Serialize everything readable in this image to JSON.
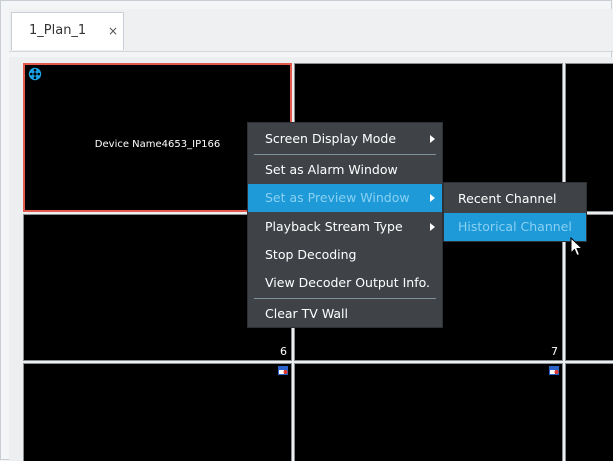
{
  "tab": {
    "label": "1_Plan_1",
    "close_glyph": "×"
  },
  "cells": {
    "c1": {
      "device_name": "Device Name4653_IP166"
    },
    "c6": {
      "number": "6"
    },
    "c7": {
      "number": "7"
    }
  },
  "context_menu": {
    "items": [
      {
        "label": "Screen Display Mode"
      },
      {
        "label": "Set as Alarm Window"
      },
      {
        "label": "Set as Preview Window"
      },
      {
        "label": "Playback Stream Type"
      },
      {
        "label": "Stop Decoding"
      },
      {
        "label": "View Decoder Output Info."
      },
      {
        "label": "Clear TV Wall"
      }
    ]
  },
  "submenu": {
    "items": [
      {
        "label": "Recent Channel"
      },
      {
        "label": "Historical Channel"
      }
    ]
  },
  "colors": {
    "selection_border": "#e45a4f",
    "menu_bg": "#3f4348",
    "highlight": "#1d9ad7"
  }
}
